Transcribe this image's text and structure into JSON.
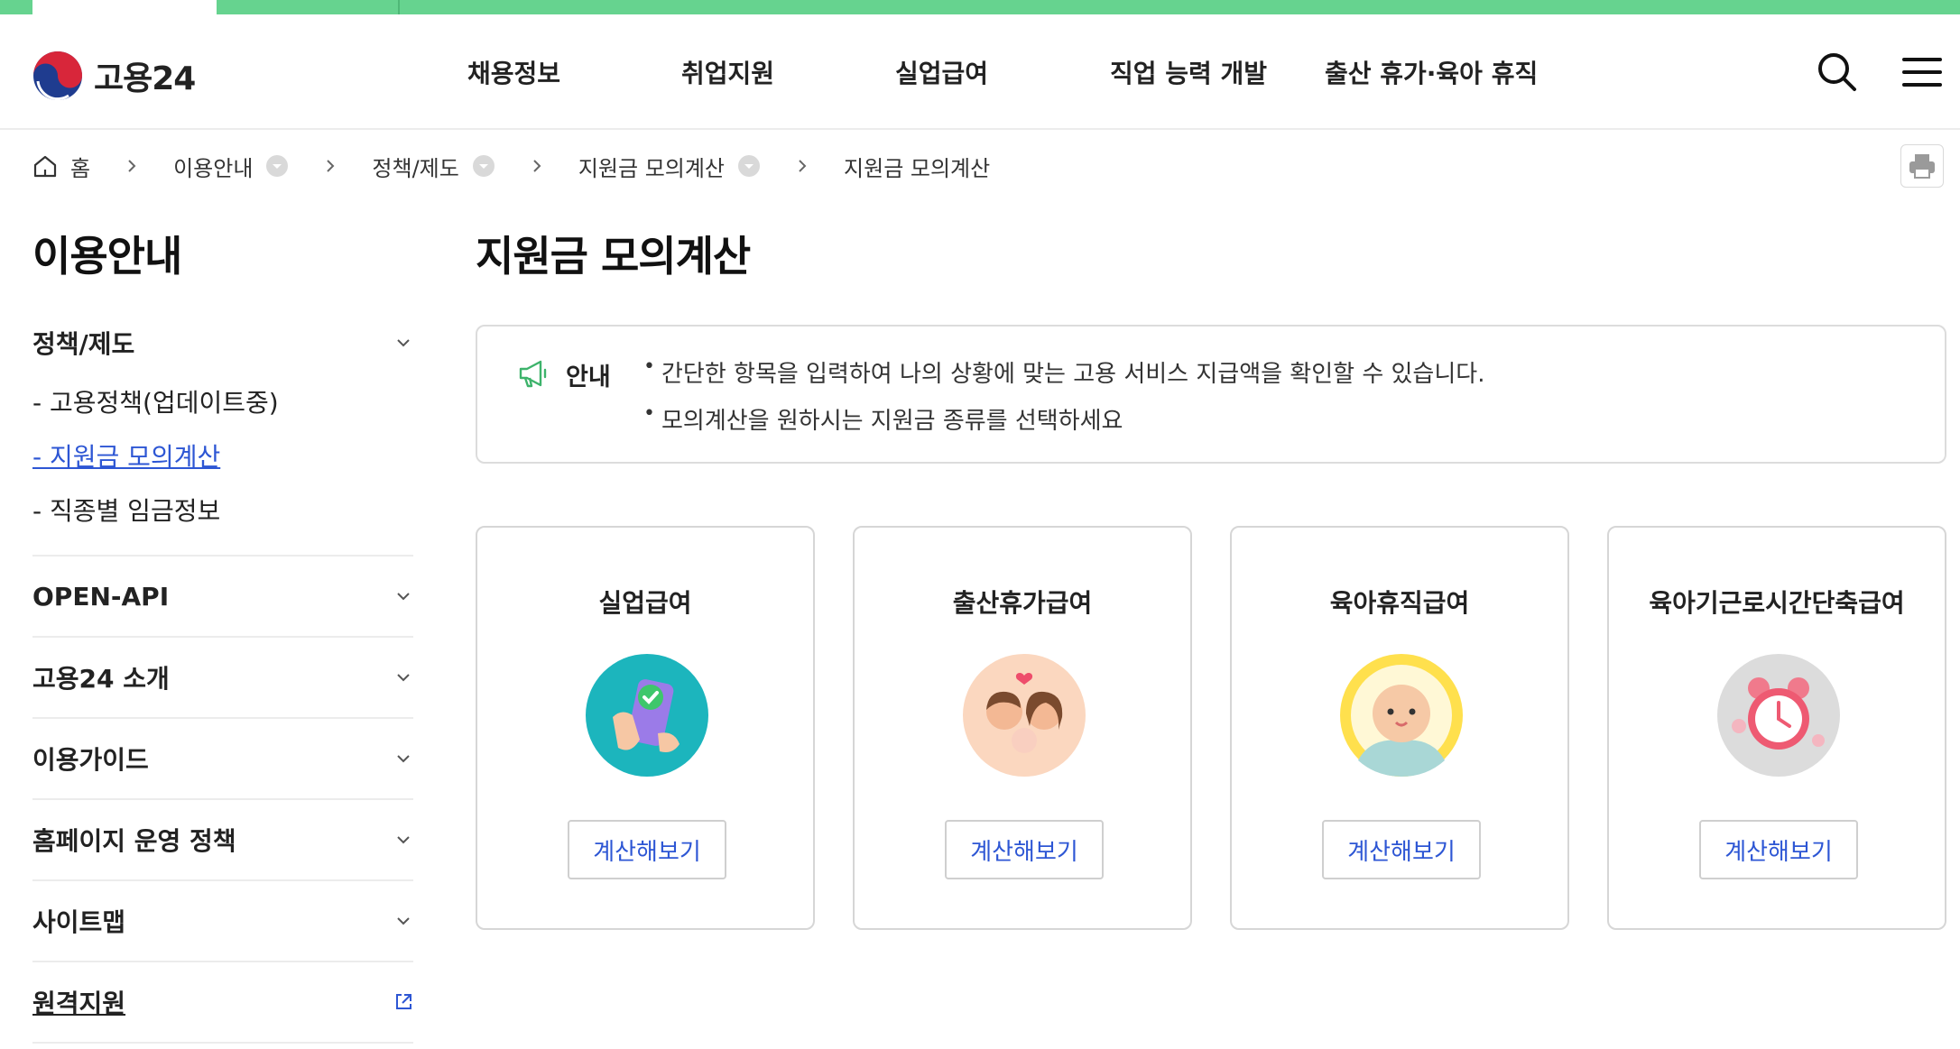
{
  "site": {
    "logo_text": "고용24"
  },
  "gnb": {
    "items": [
      "채용정보",
      "취업지원",
      "실업급여",
      "직업 능력 개발",
      "출산 휴가·육아 휴직"
    ]
  },
  "header_icons": [
    "search-icon",
    "hamburger-menu-icon"
  ],
  "breadcrumb": {
    "home": "홈",
    "items": [
      "이용안내",
      "정책/제도",
      "지원금 모의계산",
      "지원금 모의계산"
    ]
  },
  "lnb": {
    "title": "이용안내",
    "groups": [
      {
        "label": "정책/제도",
        "expanded": true,
        "sub": [
          "- 고용정책(업데이트중)",
          "- 지원금 모의계산",
          "- 직종별 임금정보"
        ],
        "active_sub_index": 1
      },
      {
        "label": "OPEN-API"
      },
      {
        "label": "고용24 소개"
      },
      {
        "label": "이용가이드"
      },
      {
        "label": "홈페이지 운영 정책"
      },
      {
        "label": "사이트맵"
      },
      {
        "label": "원격지원",
        "external": true
      }
    ]
  },
  "main": {
    "title": "지원금 모의계산",
    "notice": {
      "label": "안내",
      "lines": [
        "간단한 항목을 입력하여 나의 상황에 맞는 고용 서비스 지급액을 확인할 수 있습니다.",
        "모의계산을 원하시는 지원금 종류를 선택하세요"
      ]
    },
    "cards": [
      {
        "title": "실업급여",
        "icon": "phone-check-icon",
        "button": "계산해보기"
      },
      {
        "title": "출산휴가급여",
        "icon": "family-icon",
        "button": "계산해보기"
      },
      {
        "title": "육아휴직급여",
        "icon": "baby-icon",
        "button": "계산해보기"
      },
      {
        "title": "육아기근로시간단축급여",
        "icon": "alarm-clock-icon",
        "button": "계산해보기"
      }
    ]
  },
  "colors": {
    "brand_green": "#66d38f",
    "link_blue": "#2d56d4"
  }
}
